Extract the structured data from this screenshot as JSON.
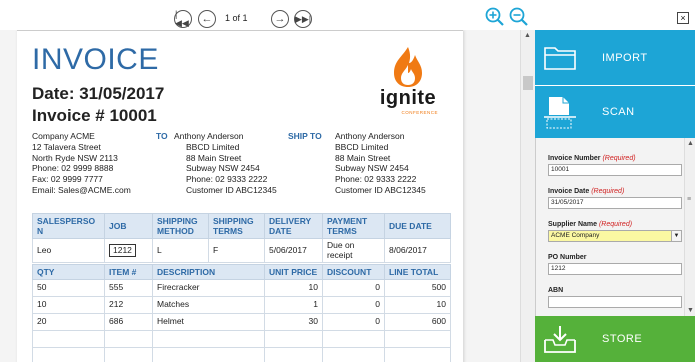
{
  "nav": {
    "first_icon": "first-page-icon",
    "prev_icon": "previous-page-icon",
    "page_indicator": "1 of 1",
    "next_icon": "next-page-icon",
    "last_icon": "last-page-icon",
    "zoom_in_icon": "zoom-in-icon",
    "zoom_out_icon": "zoom-out-icon"
  },
  "invoice": {
    "title": "INVOICE",
    "date_line": "Date: 31/05/2017",
    "number_line": "Invoice # 10001",
    "logo_word": "ignite",
    "logo_sub": "CONFERENCE",
    "from": [
      "Company ACME",
      "12 Talavera Street",
      "North Ryde NSW 2113",
      "Phone: 02 9999 8888",
      "Fax: 02 9999 7777",
      "Email: Sales@ACME.com"
    ],
    "to_label": "TO",
    "to": [
      "Anthony Anderson",
      "BBCD Limited",
      "88 Main Street",
      "Subway NSW 2454",
      "Phone: 02 9333 2222",
      "Customer ID ABC12345"
    ],
    "ship_label": "SHIP TO",
    "ship_to": [
      "Anthony Anderson",
      "BBCD Limited",
      "88 Main Street",
      "Subway NSW 2454",
      "Phone: 02 9333 2222",
      "Customer ID ABC12345"
    ],
    "meta_headers": [
      "SALESPERSO N",
      "JOB",
      "SHIPPING METHOD",
      "SHIPPING TERMS",
      "DELIVERY DATE",
      "PAYMENT TERMS",
      "DUE DATE"
    ],
    "meta_values": [
      "Leo",
      "1212",
      "L",
      "F",
      "5/06/2017",
      "Due on receipt",
      "8/06/2017"
    ],
    "line_headers": [
      "QTY",
      "ITEM #",
      "DESCRIPTION",
      "UNIT PRICE",
      "DISCOUNT",
      "LINE TOTAL"
    ],
    "lines": [
      [
        "50",
        "555",
        "Firecracker",
        "10",
        "0",
        "500"
      ],
      [
        "10",
        "212",
        "Matches",
        "1",
        "0",
        "10"
      ],
      [
        "20",
        "686",
        "Helmet",
        "30",
        "0",
        "600"
      ],
      [
        "",
        "",
        "",
        "",
        "",
        ""
      ],
      [
        "",
        "",
        "",
        "",
        "",
        ""
      ]
    ]
  },
  "panel": {
    "close_label": "×",
    "import_label": "IMPORT",
    "scan_label": "SCAN",
    "store_label": "STORE",
    "fields": {
      "invoice_number": {
        "label": "Invoice Number",
        "req": "(Required)",
        "value": "10001"
      },
      "invoice_date": {
        "label": "Invoice Date",
        "req": "(Required)",
        "value": "31/05/2017"
      },
      "supplier_name": {
        "label": "Supplier Name",
        "req": "(Required)",
        "value": "ACME Company"
      },
      "po_number": {
        "label": "PO Number",
        "value": "1212"
      },
      "abn": {
        "label": "ABN",
        "value": ""
      }
    }
  },
  "colors": {
    "accent": "#1da5d6",
    "store": "#55b13a",
    "heading": "#2e6aa6",
    "required": "#d02020"
  }
}
